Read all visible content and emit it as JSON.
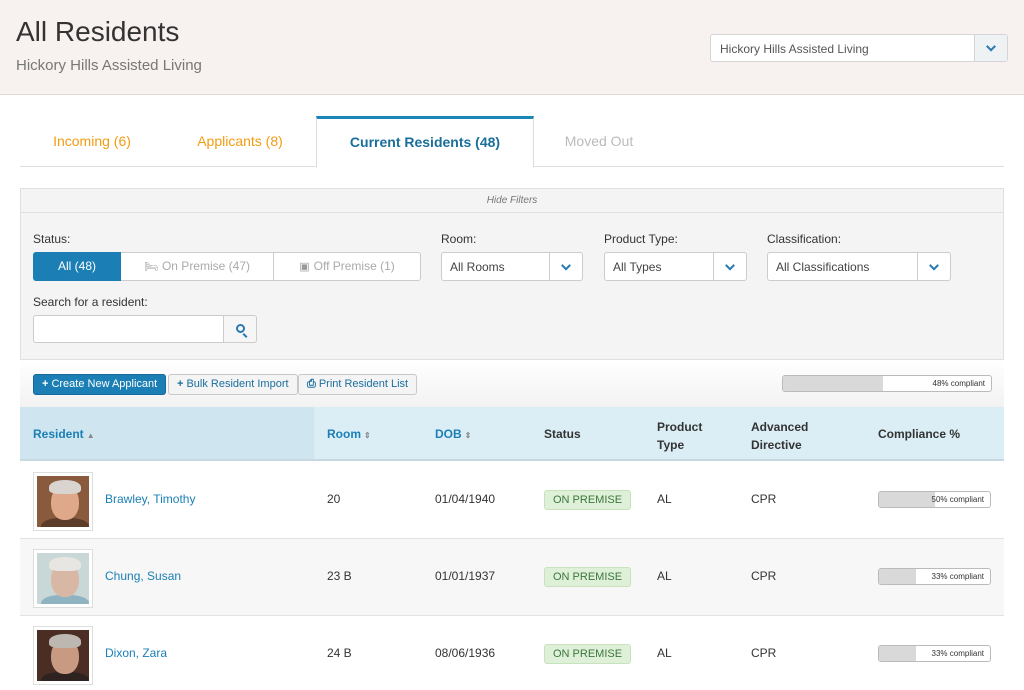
{
  "header": {
    "title": "All Residents",
    "subtitle": "Hickory Hills Assisted Living",
    "facility_select": "Hickory Hills Assisted Living"
  },
  "tabs": [
    {
      "label": "Incoming  (6)"
    },
    {
      "label": "Applicants  (8)"
    },
    {
      "label": "Current Residents  (48)"
    },
    {
      "label": "Moved Out"
    }
  ],
  "filters": {
    "hide_label": "Hide Filters",
    "status_label": "Status:",
    "status_options": [
      "All (48)",
      "On Premise (47)",
      "Off Premise (1)"
    ],
    "room_label": "Room:",
    "room_value": "All Rooms",
    "product_label": "Product Type:",
    "product_value": "All Types",
    "class_label": "Classification:",
    "class_value": "All Classifications",
    "search_label": "Search for a resident:",
    "search_value": ""
  },
  "actions": {
    "create": "Create New Applicant",
    "bulk": "Bulk Resident Import",
    "print": "Print Resident List",
    "overall_compliance_text": "48% compliant",
    "overall_compliance": 48
  },
  "table": {
    "headers": [
      "Resident",
      "Room",
      "DOB",
      "Status",
      "Product Type",
      "Advanced Directive",
      "Compliance %"
    ],
    "rows": [
      {
        "name": "Brawley, Timothy",
        "room": "20",
        "dob": "01/04/1940",
        "status": "ON PREMISE",
        "product": "AL",
        "directive": "CPR",
        "compliance": 50,
        "compliance_text": "50% compliant"
      },
      {
        "name": "Chung, Susan",
        "room": "23 B",
        "dob": "01/01/1937",
        "status": "ON PREMISE",
        "product": "AL",
        "directive": "CPR",
        "compliance": 33,
        "compliance_text": "33% compliant"
      },
      {
        "name": "Dixon, Zara",
        "room": "24 B",
        "dob": "08/06/1936",
        "status": "ON PREMISE",
        "product": "AL",
        "directive": "CPR",
        "compliance": 33,
        "compliance_text": "33% compliant"
      }
    ]
  },
  "colors": {
    "accent": "#1b7fb5",
    "orange": "#f39c12",
    "badge_green": "#3c763d"
  }
}
